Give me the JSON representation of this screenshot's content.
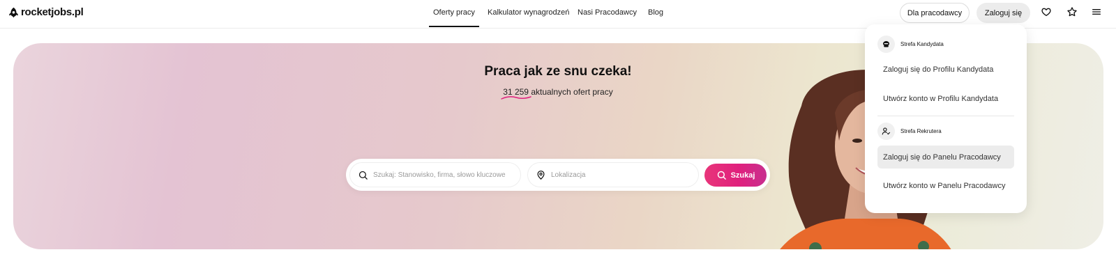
{
  "brand": {
    "logo_text": "rocketjobs.pl"
  },
  "nav": {
    "items": [
      {
        "label": "Oferty pracy",
        "active": true
      },
      {
        "label": "Kalkulator wynagrodzeń",
        "active": false
      },
      {
        "label": "Nasi Pracodawcy",
        "active": false
      },
      {
        "label": "Blog",
        "active": false
      }
    ]
  },
  "header_actions": {
    "employers_label": "Dla pracodawcy",
    "login_label": "Zaloguj się",
    "icons": [
      "heart-icon",
      "star-icon",
      "menu-icon"
    ]
  },
  "hero": {
    "headline": "Praca jak ze snu czeka!",
    "offers_count": "31 259",
    "offers_suffix": " aktualnych ofert pracy",
    "search_placeholder": "Szukaj: Stanowisko, firma, słowo kluczowe",
    "location_placeholder": "Lokalizacja",
    "search_button": "Szukaj"
  },
  "login_menu": {
    "candidate_zone": {
      "title": "Strefa Kandydata",
      "items": [
        "Zaloguj się do Profilu Kandydata",
        "Utwórz konto w Profilu Kandydata"
      ]
    },
    "recruiter_zone": {
      "title": "Strefa Rekrutera",
      "items": [
        "Zaloguj się do Panelu Pracodawcy",
        "Utwórz konto w Panelu Pracodawcy"
      ]
    },
    "hovered_item": "Zaloguj się do Panelu Pracodawcy"
  },
  "colors": {
    "accent": "#e0207d",
    "text": "#111111",
    "menu_hover": "#ececec"
  }
}
